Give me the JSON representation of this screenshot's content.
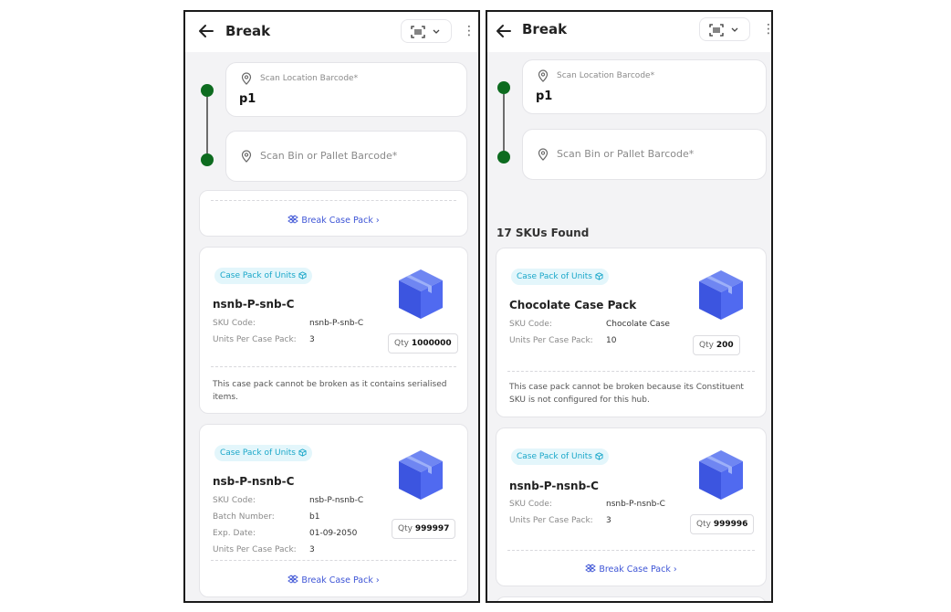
{
  "colors": {
    "accent_green": "#0d6b1f",
    "chip_bg": "#e3f6fb",
    "chip_text": "#1aa7c9",
    "link_blue": "#3e55d6",
    "box_blue": "#4a63e8"
  },
  "left": {
    "header": {
      "title": "Break",
      "back_icon": "arrow-left-icon",
      "scan_icon": "barcode-scan-icon",
      "menu_icon": "more-vertical-icon",
      "menu_glyph": "⋮"
    },
    "location": {
      "label": "Scan Location Barcode*",
      "value": "p1"
    },
    "bin": {
      "placeholder": "Scan Bin or Pallet Barcode*"
    },
    "partial_card": {
      "break_label": "Break Case Pack",
      "chev": "›"
    },
    "cards": [
      {
        "chip": "Case Pack of Units",
        "name": "nsnb-P-snb-C",
        "fields": [
          {
            "label": "SKU Code:",
            "value": "nsnb-P-snb-C"
          },
          {
            "label": "Units Per Case Pack:",
            "value": "3"
          }
        ],
        "qty_label": "Qty",
        "qty_value": "1000000",
        "note": "This case pack cannot be broken as it contains serialised items."
      },
      {
        "chip": "Case Pack of Units",
        "name": "nsb-P-nsnb-C",
        "fields": [
          {
            "label": "SKU Code:",
            "value": "nsb-P-nsnb-C"
          },
          {
            "label": "Batch Number:",
            "value": "b1"
          },
          {
            "label": "Exp. Date:",
            "value": "01-09-2050"
          },
          {
            "label": "Units Per Case Pack:",
            "value": "3"
          }
        ],
        "qty_label": "Qty",
        "qty_value": "999997",
        "break_label": "Break Case Pack",
        "chev": "›"
      }
    ]
  },
  "right": {
    "header": {
      "title": "Break",
      "back_icon": "arrow-left-icon",
      "scan_icon": "barcode-scan-icon",
      "menu_icon": "more-vertical-icon",
      "menu_glyph": "⋮"
    },
    "location": {
      "label": "Scan Location Barcode*",
      "value": "p1"
    },
    "bin": {
      "placeholder": "Scan Bin or Pallet Barcode*"
    },
    "found": "17 SKUs Found",
    "cards": [
      {
        "chip": "Case Pack of Units",
        "name": "Chocolate Case Pack",
        "fields": [
          {
            "label": "SKU Code:",
            "value": "Chocolate Case"
          },
          {
            "label": "Units Per Case Pack:",
            "value": "10"
          }
        ],
        "qty_label": "Qty",
        "qty_value": "200",
        "note": "This case pack cannot be broken because its Constituent SKU is not configured for this hub."
      },
      {
        "chip": "Case Pack of Units",
        "name": "nsnb-P-nsnb-C",
        "fields": [
          {
            "label": "SKU Code:",
            "value": "nsnb-P-nsnb-C"
          },
          {
            "label": "Units Per Case Pack:",
            "value": "3"
          }
        ],
        "qty_label": "Qty",
        "qty_value": "999996",
        "break_label": "Break Case Pack",
        "chev": "›"
      }
    ]
  }
}
